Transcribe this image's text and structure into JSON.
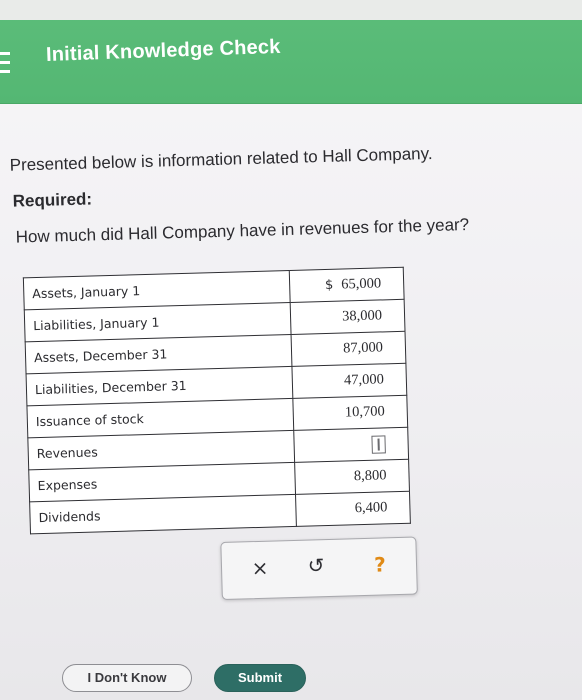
{
  "header": {
    "title": "Initial Knowledge Check"
  },
  "question": {
    "intro": "Presented below is information related to Hall Company.",
    "required_label": "Required:",
    "prompt": "How much did Hall Company have in revenues for the year?"
  },
  "table": {
    "currency_symbol": "$",
    "rows": [
      {
        "label": "Assets, January 1",
        "value": "65,000"
      },
      {
        "label": "Liabilities, January 1",
        "value": "38,000"
      },
      {
        "label": "Assets, December 31",
        "value": "87,000"
      },
      {
        "label": "Liabilities, December 31",
        "value": "47,000"
      },
      {
        "label": "Issuance of stock",
        "value": "10,700"
      },
      {
        "label": "Revenues",
        "value": ""
      },
      {
        "label": "Expenses",
        "value": "8,800"
      },
      {
        "label": "Dividends",
        "value": "6,400"
      }
    ]
  },
  "popover": {
    "close_glyph": "×",
    "undo_glyph": "↺",
    "help_glyph": "?"
  },
  "buttons": {
    "dont_know": "I Don't Know",
    "submit": "Submit"
  },
  "colors": {
    "header_green": "#5cbd7a",
    "submit_teal": "#2e6e66",
    "help_orange": "#e08a16"
  }
}
